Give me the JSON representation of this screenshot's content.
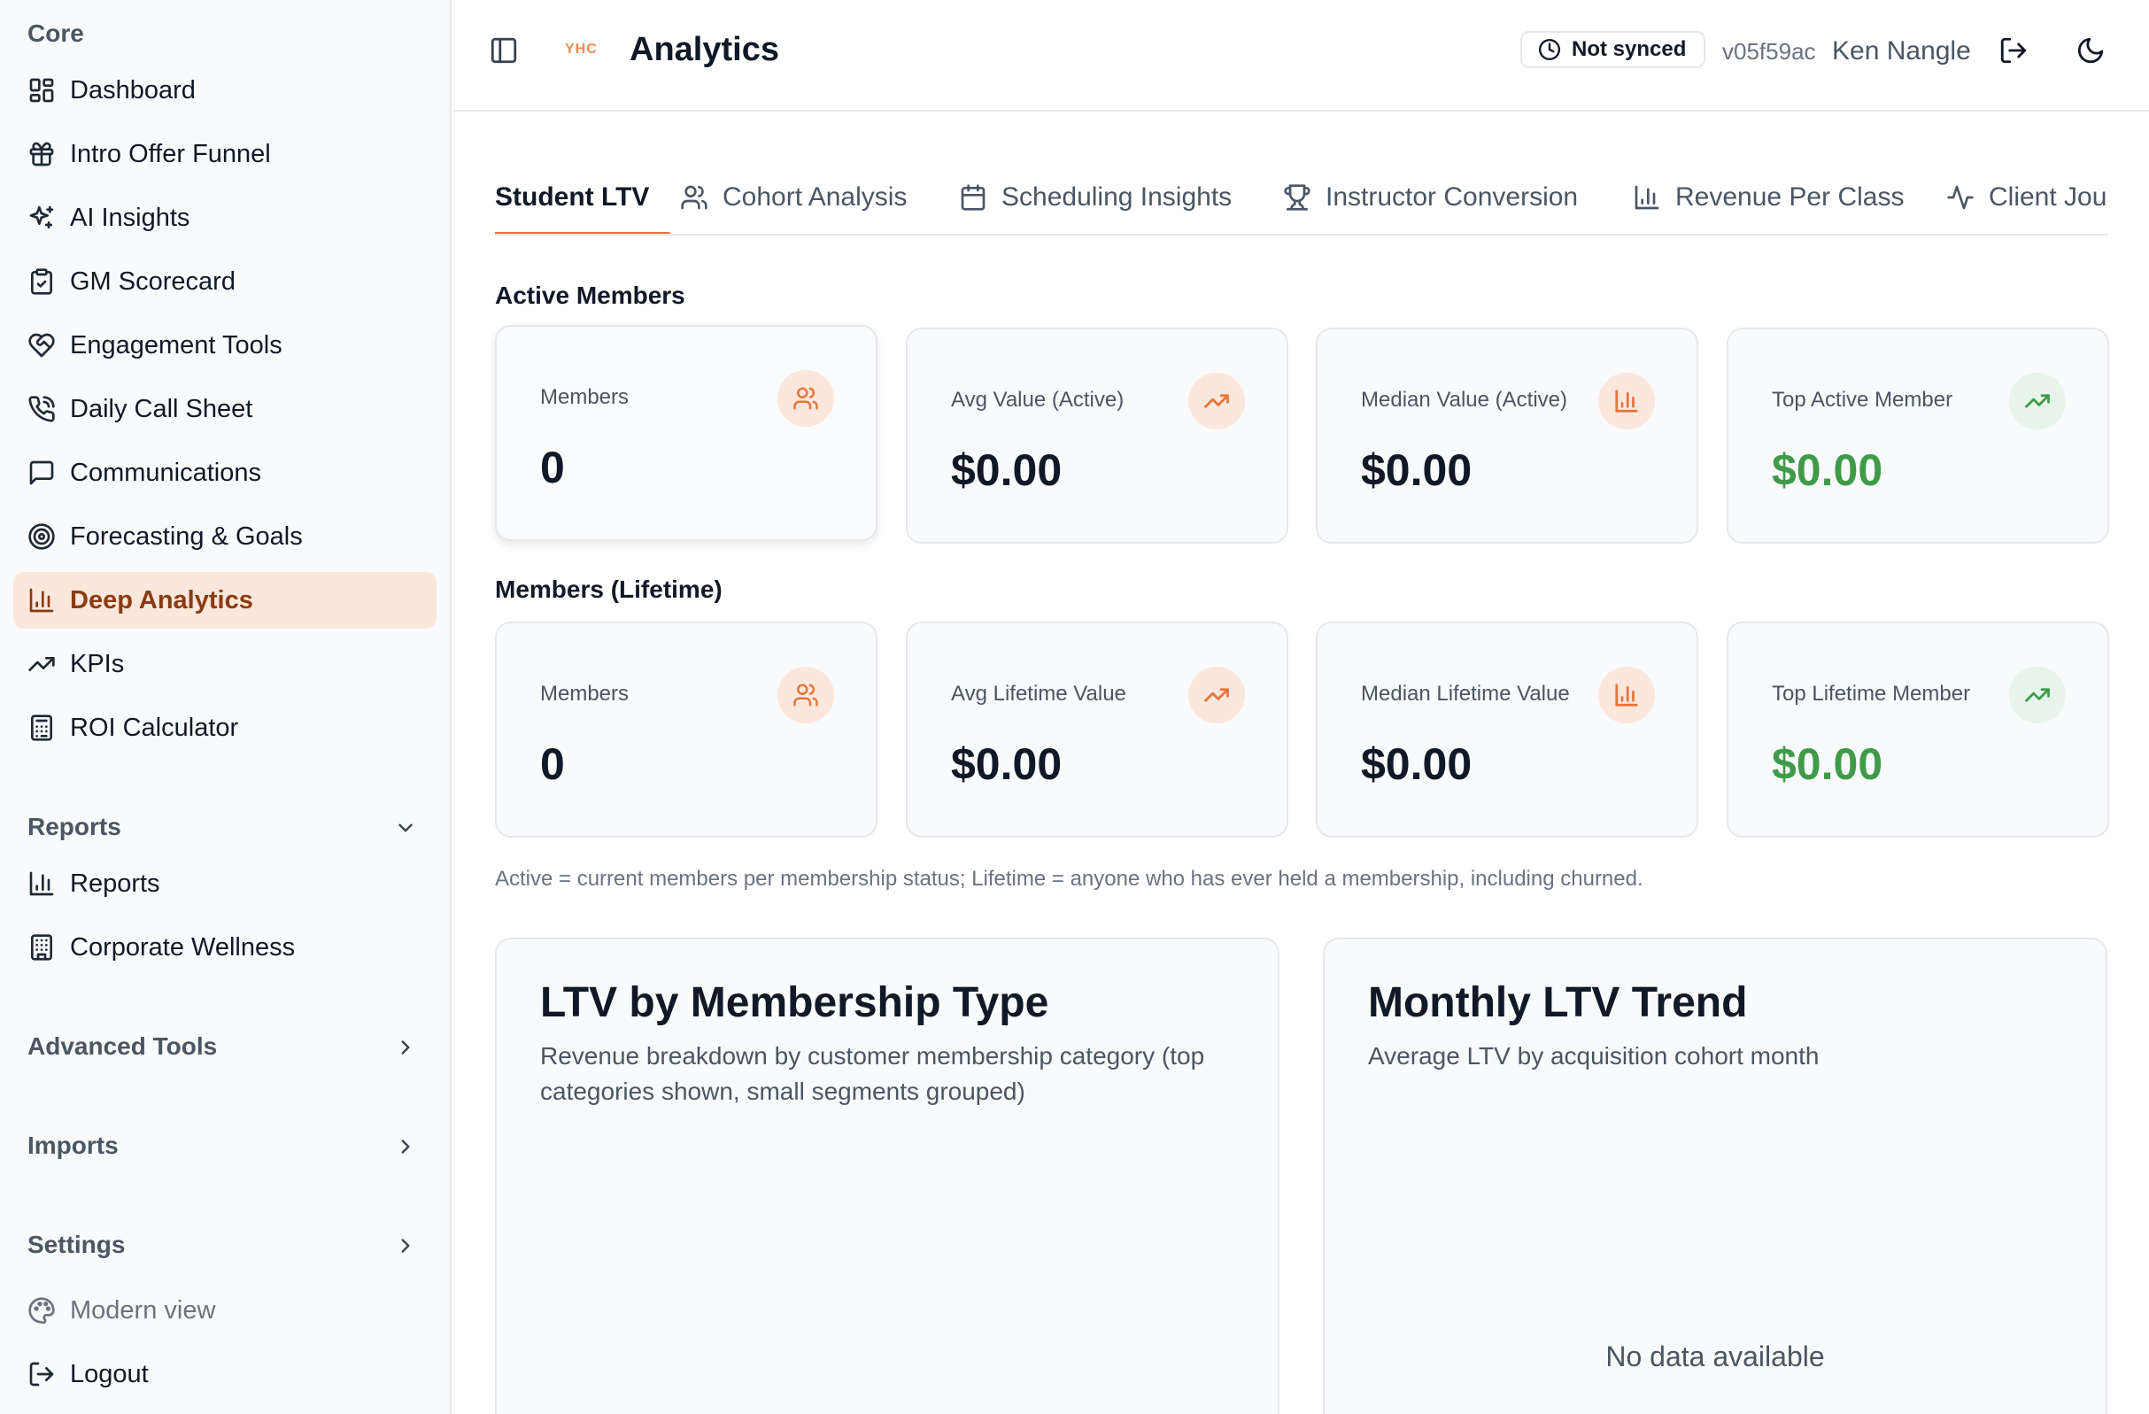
{
  "sidebar": {
    "core_title": "Core",
    "core_items": [
      {
        "label": "Dashboard",
        "icon": "layout-dashboard-icon"
      },
      {
        "label": "Intro Offer Funnel",
        "icon": "gift-icon"
      },
      {
        "label": "AI Insights",
        "icon": "sparkles-icon"
      },
      {
        "label": "GM Scorecard",
        "icon": "clipboard-check-icon"
      },
      {
        "label": "Engagement Tools",
        "icon": "heart-handshake-icon"
      },
      {
        "label": "Daily Call Sheet",
        "icon": "phone-call-icon"
      },
      {
        "label": "Communications",
        "icon": "message-square-icon"
      },
      {
        "label": "Forecasting & Goals",
        "icon": "target-icon"
      },
      {
        "label": "Deep Analytics",
        "icon": "bar-chart-icon",
        "active": true
      },
      {
        "label": "KPIs",
        "icon": "trending-up-icon"
      },
      {
        "label": "ROI Calculator",
        "icon": "calculator-icon"
      }
    ],
    "reports_title": "Reports",
    "reports_items": [
      {
        "label": "Reports",
        "icon": "bar-chart-icon"
      },
      {
        "label": "Corporate Wellness",
        "icon": "building-icon"
      }
    ],
    "advanced_title": "Advanced Tools",
    "imports_title": "Imports",
    "settings_title": "Settings",
    "modern_view": "Modern view",
    "logout": "Logout"
  },
  "header": {
    "logo_text": "YHC",
    "title": "Analytics",
    "sync_status": "Not synced",
    "version": "v05f59ac",
    "user": "Ken Nangle"
  },
  "tabs": [
    {
      "label": "Student LTV",
      "icon": "",
      "active": true
    },
    {
      "label": "Cohort Analysis",
      "icon": "users-icon"
    },
    {
      "label": "Scheduling Insights",
      "icon": "calendar-icon"
    },
    {
      "label": "Instructor Conversion",
      "icon": "trophy-icon"
    },
    {
      "label": "Revenue Per Class",
      "icon": "bar-chart-icon"
    },
    {
      "label": "Client Journey",
      "icon": "activity-icon"
    }
  ],
  "active_members": {
    "title": "Active Members",
    "cards": [
      {
        "label": "Members",
        "value": "0",
        "icon": "users-icon"
      },
      {
        "label": "Avg Value (Active)",
        "value": "$0.00",
        "icon": "trending-up-icon"
      },
      {
        "label": "Median Value (Active)",
        "value": "$0.00",
        "icon": "bar-chart-icon"
      },
      {
        "label": "Top Active Member",
        "value": "$0.00",
        "icon": "trending-up-icon"
      }
    ]
  },
  "lifetime_members": {
    "title": "Members (Lifetime)",
    "cards": [
      {
        "label": "Members",
        "value": "0",
        "icon": "users-icon"
      },
      {
        "label": "Avg Lifetime Value",
        "value": "$0.00",
        "icon": "trending-up-icon"
      },
      {
        "label": "Median Lifetime Value",
        "value": "$0.00",
        "icon": "bar-chart-icon"
      },
      {
        "label": "Top Lifetime Member",
        "value": "$0.00",
        "icon": "trending-up-icon"
      }
    ]
  },
  "footnote": "Active = current members per membership status; Lifetime = anyone who has ever held a membership, including churned.",
  "ltv_by_type": {
    "title": "LTV by Membership Type",
    "subtitle": "Revenue breakdown by customer membership category (top categories shown, small segments grouped)"
  },
  "ltv_trend": {
    "title": "Monthly LTV Trend",
    "subtitle": "Average LTV by acquisition cohort month",
    "empty": "No data available"
  },
  "colors": {
    "accent": "#e8743b",
    "accent_soft": "#fbe7dc",
    "positive": "#3f9b4a",
    "active_nav_text": "#8a3b12"
  }
}
